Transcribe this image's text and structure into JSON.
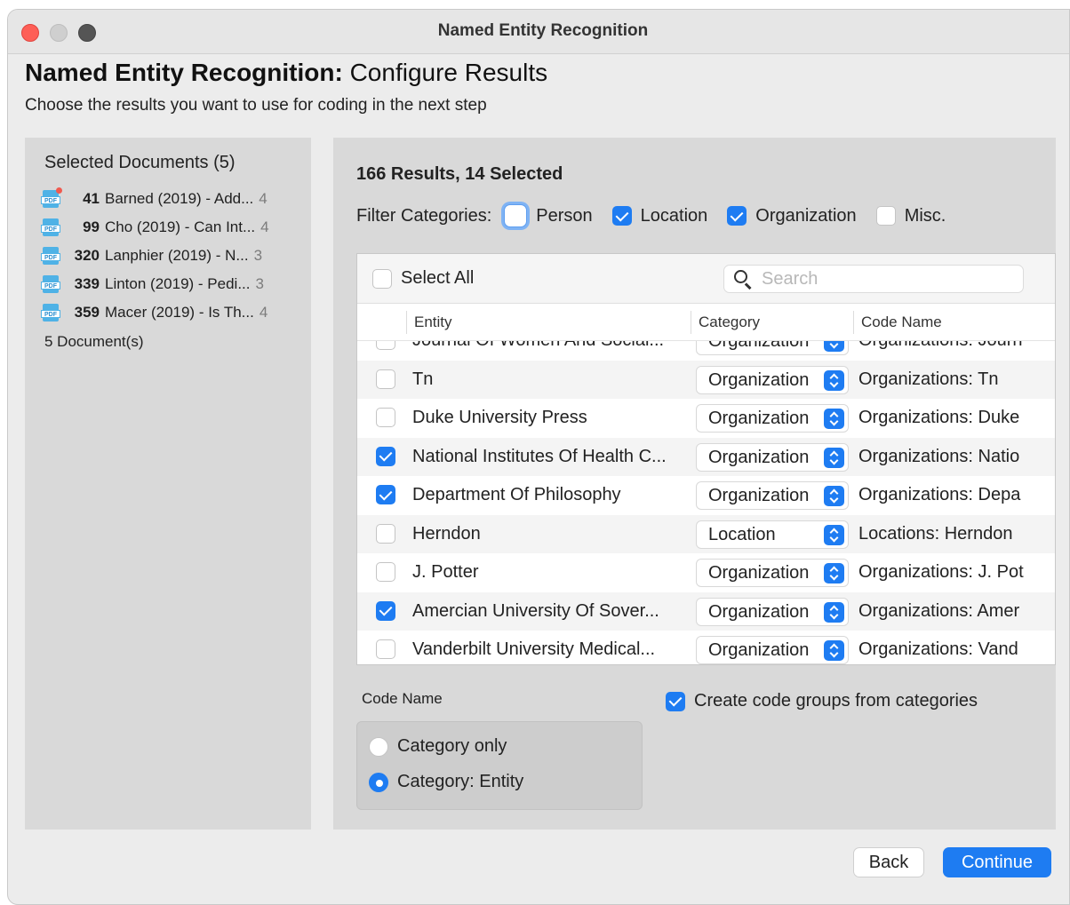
{
  "window": {
    "title": "Named Entity Recognition"
  },
  "page": {
    "heading_bold": "Named Entity Recognition:",
    "heading_rest": " Configure Results",
    "subheading": "Choose the results you want to use for coding in the next step"
  },
  "documents": {
    "title": "Selected Documents (5)",
    "items": [
      {
        "num": "41",
        "label": "Barned (2019) - Add...",
        "count": "4",
        "icon": "pdf-icon"
      },
      {
        "num": "99",
        "label": "Cho (2019) - Can Int...",
        "count": "4",
        "icon": "pdf-icon"
      },
      {
        "num": "320",
        "label": "Lanphier (2019) - N...",
        "count": "3",
        "icon": "pdf-icon"
      },
      {
        "num": "339",
        "label": "Linton (2019) - Pedi...",
        "count": "3",
        "icon": "pdf-icon"
      },
      {
        "num": "359",
        "label": "Macer (2019) - Is Th...",
        "count": "4",
        "icon": "pdf-icon"
      }
    ],
    "footer": "5 Document(s)"
  },
  "results": {
    "summary": "166 Results, 14 Selected",
    "filter_label": "Filter Categories:",
    "filters": [
      {
        "label": "Person",
        "checked": false
      },
      {
        "label": "Location",
        "checked": true
      },
      {
        "label": "Organization",
        "checked": true
      },
      {
        "label": "Misc.",
        "checked": false
      }
    ]
  },
  "table": {
    "select_all_label": "Select All",
    "search_placeholder": "Search",
    "columns": [
      "Entity",
      "Category",
      "Code Name"
    ],
    "rows": [
      {
        "checked": false,
        "entity": "Journal Of Women And Social...",
        "category": "Organization",
        "code_name": "Organizations: Journ"
      },
      {
        "checked": false,
        "entity": "Tn",
        "category": "Organization",
        "code_name": "Organizations: Tn"
      },
      {
        "checked": false,
        "entity": "Duke University Press",
        "category": "Organization",
        "code_name": "Organizations: Duke"
      },
      {
        "checked": true,
        "entity": "National Institutes Of Health C...",
        "category": "Organization",
        "code_name": "Organizations: Natio"
      },
      {
        "checked": true,
        "entity": "Department Of Philosophy",
        "category": "Organization",
        "code_name": "Organizations: Depa"
      },
      {
        "checked": false,
        "entity": "Herndon",
        "category": "Location",
        "code_name": "Locations: Herndon"
      },
      {
        "checked": false,
        "entity": "J. Potter",
        "category": "Organization",
        "code_name": "Organizations: J. Pot"
      },
      {
        "checked": true,
        "entity": "Amercian University Of Sover...",
        "category": "Organization",
        "code_name": "Organizations: Amer"
      },
      {
        "checked": false,
        "entity": "Vanderbilt University Medical...",
        "category": "Organization",
        "code_name": "Organizations: Vand"
      }
    ]
  },
  "options": {
    "code_name_label": "Code Name",
    "radio_options": [
      {
        "label": "Category only",
        "selected": false
      },
      {
        "label": "Category: Entity",
        "selected": true
      }
    ],
    "create_groups_label": "Create code groups from categories",
    "create_groups_checked": true
  },
  "buttons": {
    "back": "Back",
    "continue": "Continue"
  },
  "colors": {
    "accent": "#1e7cf2",
    "close": "#fe5f57"
  }
}
